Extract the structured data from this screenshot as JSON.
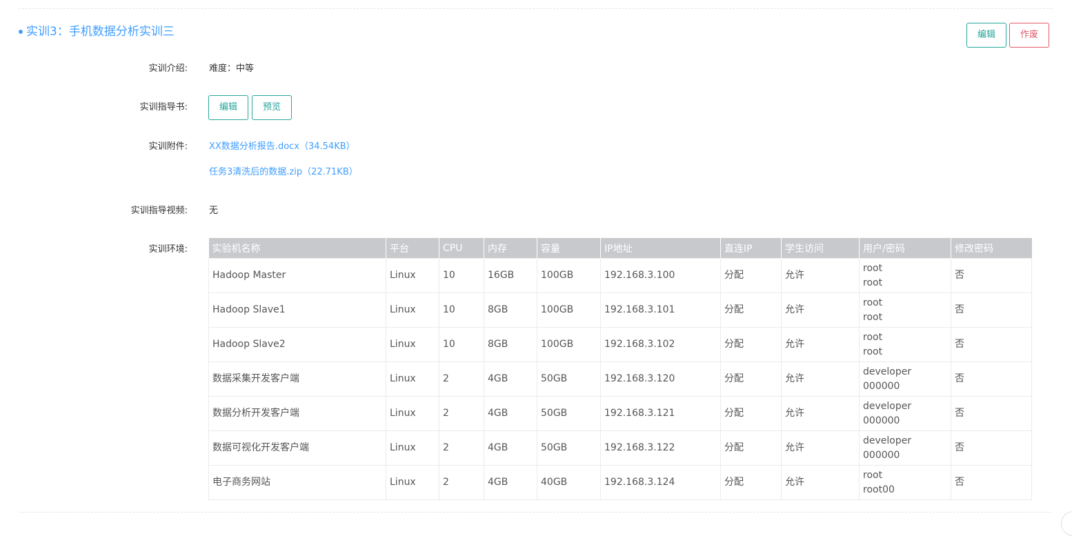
{
  "section": {
    "title": "实训3：手机数据分析实训三",
    "edit_label": "编辑",
    "void_label": "作废"
  },
  "fields": {
    "intro_label": "实训介绍:",
    "intro_value": "难度：中等",
    "guide_label": "实训指导书:",
    "guide_edit_label": "编辑",
    "guide_preview_label": "预览",
    "attach_label": "实训附件:",
    "attachments": [
      "XX数据分析报告.docx（34.54KB）",
      "任务3清洗后的数据.zip（22.71KB）"
    ],
    "video_label": "实训指导视频:",
    "video_value": "无",
    "env_label": "实训环境:"
  },
  "table": {
    "headers": [
      "实验机名称",
      "平台",
      "CPU",
      "内存",
      "容量",
      "IP地址",
      "直连IP",
      "学生访问",
      "用户/密码",
      "修改密码"
    ],
    "rows": [
      {
        "name": "Hadoop Master",
        "platform": "Linux",
        "cpu": "10",
        "mem": "16GB",
        "disk": "100GB",
        "ip": "192.168.3.100",
        "direct": "分配",
        "access": "允许",
        "user": "root",
        "pass": "root",
        "modify": "否"
      },
      {
        "name": "Hadoop Slave1",
        "platform": "Linux",
        "cpu": "10",
        "mem": "8GB",
        "disk": "100GB",
        "ip": "192.168.3.101",
        "direct": "分配",
        "access": "允许",
        "user": "root",
        "pass": "root",
        "modify": "否"
      },
      {
        "name": "Hadoop Slave2",
        "platform": "Linux",
        "cpu": "10",
        "mem": "8GB",
        "disk": "100GB",
        "ip": "192.168.3.102",
        "direct": "分配",
        "access": "允许",
        "user": "root",
        "pass": "root",
        "modify": "否"
      },
      {
        "name": "数据采集开发客户端",
        "platform": "Linux",
        "cpu": "2",
        "mem": "4GB",
        "disk": "50GB",
        "ip": "192.168.3.120",
        "direct": "分配",
        "access": "允许",
        "user": "developer",
        "pass": "000000",
        "modify": "否"
      },
      {
        "name": "数据分析开发客户端",
        "platform": "Linux",
        "cpu": "2",
        "mem": "4GB",
        "disk": "50GB",
        "ip": "192.168.3.121",
        "direct": "分配",
        "access": "允许",
        "user": "developer",
        "pass": "000000",
        "modify": "否"
      },
      {
        "name": "数据可视化开发客户端",
        "platform": "Linux",
        "cpu": "2",
        "mem": "4GB",
        "disk": "50GB",
        "ip": "192.168.3.122",
        "direct": "分配",
        "access": "允许",
        "user": "developer",
        "pass": "000000",
        "modify": "否"
      },
      {
        "name": "电子商务网站",
        "platform": "Linux",
        "cpu": "2",
        "mem": "4GB",
        "disk": "40GB",
        "ip": "192.168.3.124",
        "direct": "分配",
        "access": "允许",
        "user": "root",
        "pass": "root00",
        "modify": "否"
      }
    ]
  },
  "colors": {
    "accent": "#409eff",
    "green": "#26a69a",
    "red": "#e05a6a",
    "table_header_bg": "#c8c9cc"
  }
}
